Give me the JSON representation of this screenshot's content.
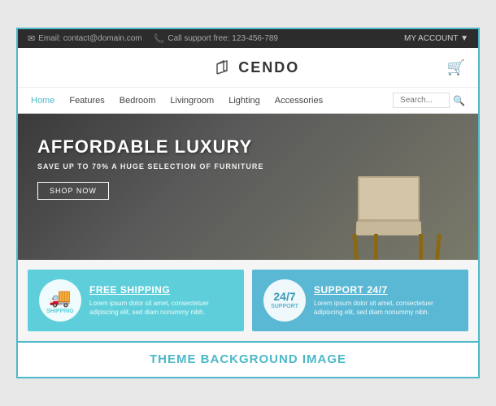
{
  "topbar": {
    "email_label": "Email: contact@domain.com",
    "phone_label": "Call support free: 123-456-789",
    "account_label": "MY ACCOUNT ▼"
  },
  "header": {
    "logo_text": "CENDO"
  },
  "nav": {
    "links": [
      {
        "label": "Home",
        "active": true
      },
      {
        "label": "Features",
        "active": false
      },
      {
        "label": "Bedroom",
        "active": false
      },
      {
        "label": "Livingroom",
        "active": false
      },
      {
        "label": "Lighting",
        "active": false
      },
      {
        "label": "Accessories",
        "active": false
      }
    ],
    "search_placeholder": "Search..."
  },
  "hero": {
    "title": "AFFORDABLE LUXURY",
    "subtitle": "SAVE UP TO 70% A HUGE SELECTION OF FURNITURE",
    "button_label": "SHOP NOW"
  },
  "features": [
    {
      "icon": "🚚",
      "icon_label": "SHIPPING",
      "title": "FREE SHIPPING",
      "desc": "Lorem ipsum dolor sit amet, consectetuer adipiscing elit, sed diam nonummy nibh."
    },
    {
      "clock_top": "24/7",
      "clock_bottom": "SUPPORT",
      "title": "SUPPORT 24/7",
      "desc": "Lorem ipsum dolor sit amet, consectetuer adipiscing elit, sed diam nonummy nibh."
    }
  ],
  "bottom_label": "THEME BACKGROUND IMAGE"
}
